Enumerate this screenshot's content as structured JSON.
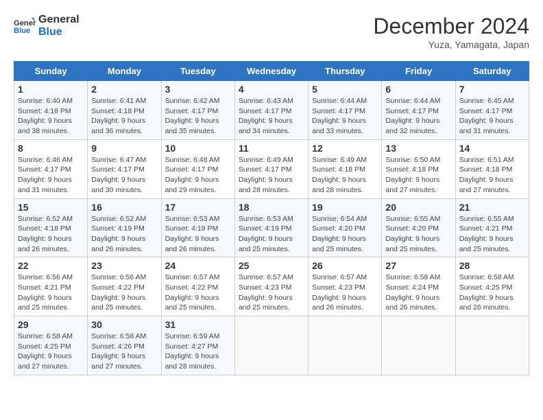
{
  "header": {
    "logo_line1": "General",
    "logo_line2": "Blue",
    "month": "December 2024",
    "location": "Yuza, Yamagata, Japan"
  },
  "weekdays": [
    "Sunday",
    "Monday",
    "Tuesday",
    "Wednesday",
    "Thursday",
    "Friday",
    "Saturday"
  ],
  "weeks": [
    [
      {
        "day": "1",
        "sunrise": "Sunrise: 6:40 AM",
        "sunset": "Sunset: 4:18 PM",
        "daylight": "Daylight: 9 hours and 38 minutes."
      },
      {
        "day": "2",
        "sunrise": "Sunrise: 6:41 AM",
        "sunset": "Sunset: 4:18 PM",
        "daylight": "Daylight: 9 hours and 36 minutes."
      },
      {
        "day": "3",
        "sunrise": "Sunrise: 6:42 AM",
        "sunset": "Sunset: 4:17 PM",
        "daylight": "Daylight: 9 hours and 35 minutes."
      },
      {
        "day": "4",
        "sunrise": "Sunrise: 6:43 AM",
        "sunset": "Sunset: 4:17 PM",
        "daylight": "Daylight: 9 hours and 34 minutes."
      },
      {
        "day": "5",
        "sunrise": "Sunrise: 6:44 AM",
        "sunset": "Sunset: 4:17 PM",
        "daylight": "Daylight: 9 hours and 33 minutes."
      },
      {
        "day": "6",
        "sunrise": "Sunrise: 6:44 AM",
        "sunset": "Sunset: 4:17 PM",
        "daylight": "Daylight: 9 hours and 32 minutes."
      },
      {
        "day": "7",
        "sunrise": "Sunrise: 6:45 AM",
        "sunset": "Sunset: 4:17 PM",
        "daylight": "Daylight: 9 hours and 31 minutes."
      }
    ],
    [
      {
        "day": "8",
        "sunrise": "Sunrise: 6:46 AM",
        "sunset": "Sunset: 4:17 PM",
        "daylight": "Daylight: 9 hours and 31 minutes."
      },
      {
        "day": "9",
        "sunrise": "Sunrise: 6:47 AM",
        "sunset": "Sunset: 4:17 PM",
        "daylight": "Daylight: 9 hours and 30 minutes."
      },
      {
        "day": "10",
        "sunrise": "Sunrise: 6:48 AM",
        "sunset": "Sunset: 4:17 PM",
        "daylight": "Daylight: 9 hours and 29 minutes."
      },
      {
        "day": "11",
        "sunrise": "Sunrise: 6:49 AM",
        "sunset": "Sunset: 4:17 PM",
        "daylight": "Daylight: 9 hours and 28 minutes."
      },
      {
        "day": "12",
        "sunrise": "Sunrise: 6:49 AM",
        "sunset": "Sunset: 4:18 PM",
        "daylight": "Daylight: 9 hours and 28 minutes."
      },
      {
        "day": "13",
        "sunrise": "Sunrise: 6:50 AM",
        "sunset": "Sunset: 4:18 PM",
        "daylight": "Daylight: 9 hours and 27 minutes."
      },
      {
        "day": "14",
        "sunrise": "Sunrise: 6:51 AM",
        "sunset": "Sunset: 4:18 PM",
        "daylight": "Daylight: 9 hours and 27 minutes."
      }
    ],
    [
      {
        "day": "15",
        "sunrise": "Sunrise: 6:52 AM",
        "sunset": "Sunset: 4:18 PM",
        "daylight": "Daylight: 9 hours and 26 minutes."
      },
      {
        "day": "16",
        "sunrise": "Sunrise: 6:52 AM",
        "sunset": "Sunset: 4:19 PM",
        "daylight": "Daylight: 9 hours and 26 minutes."
      },
      {
        "day": "17",
        "sunrise": "Sunrise: 6:53 AM",
        "sunset": "Sunset: 4:19 PM",
        "daylight": "Daylight: 9 hours and 26 minutes."
      },
      {
        "day": "18",
        "sunrise": "Sunrise: 6:53 AM",
        "sunset": "Sunset: 4:19 PM",
        "daylight": "Daylight: 9 hours and 25 minutes."
      },
      {
        "day": "19",
        "sunrise": "Sunrise: 6:54 AM",
        "sunset": "Sunset: 4:20 PM",
        "daylight": "Daylight: 9 hours and 25 minutes."
      },
      {
        "day": "20",
        "sunrise": "Sunrise: 6:55 AM",
        "sunset": "Sunset: 4:20 PM",
        "daylight": "Daylight: 9 hours and 25 minutes."
      },
      {
        "day": "21",
        "sunrise": "Sunrise: 6:55 AM",
        "sunset": "Sunset: 4:21 PM",
        "daylight": "Daylight: 9 hours and 25 minutes."
      }
    ],
    [
      {
        "day": "22",
        "sunrise": "Sunrise: 6:56 AM",
        "sunset": "Sunset: 4:21 PM",
        "daylight": "Daylight: 9 hours and 25 minutes."
      },
      {
        "day": "23",
        "sunrise": "Sunrise: 6:56 AM",
        "sunset": "Sunset: 4:22 PM",
        "daylight": "Daylight: 9 hours and 25 minutes."
      },
      {
        "day": "24",
        "sunrise": "Sunrise: 6:57 AM",
        "sunset": "Sunset: 4:22 PM",
        "daylight": "Daylight: 9 hours and 25 minutes."
      },
      {
        "day": "25",
        "sunrise": "Sunrise: 6:57 AM",
        "sunset": "Sunset: 4:23 PM",
        "daylight": "Daylight: 9 hours and 25 minutes."
      },
      {
        "day": "26",
        "sunrise": "Sunrise: 6:57 AM",
        "sunset": "Sunset: 4:23 PM",
        "daylight": "Daylight: 9 hours and 26 minutes."
      },
      {
        "day": "27",
        "sunrise": "Sunrise: 6:58 AM",
        "sunset": "Sunset: 4:24 PM",
        "daylight": "Daylight: 9 hours and 26 minutes."
      },
      {
        "day": "28",
        "sunrise": "Sunrise: 6:58 AM",
        "sunset": "Sunset: 4:25 PM",
        "daylight": "Daylight: 9 hours and 26 minutes."
      }
    ],
    [
      {
        "day": "29",
        "sunrise": "Sunrise: 6:58 AM",
        "sunset": "Sunset: 4:25 PM",
        "daylight": "Daylight: 9 hours and 27 minutes."
      },
      {
        "day": "30",
        "sunrise": "Sunrise: 6:58 AM",
        "sunset": "Sunset: 4:26 PM",
        "daylight": "Daylight: 9 hours and 27 minutes."
      },
      {
        "day": "31",
        "sunrise": "Sunrise: 6:59 AM",
        "sunset": "Sunset: 4:27 PM",
        "daylight": "Daylight: 9 hours and 28 minutes."
      },
      null,
      null,
      null,
      null
    ]
  ]
}
